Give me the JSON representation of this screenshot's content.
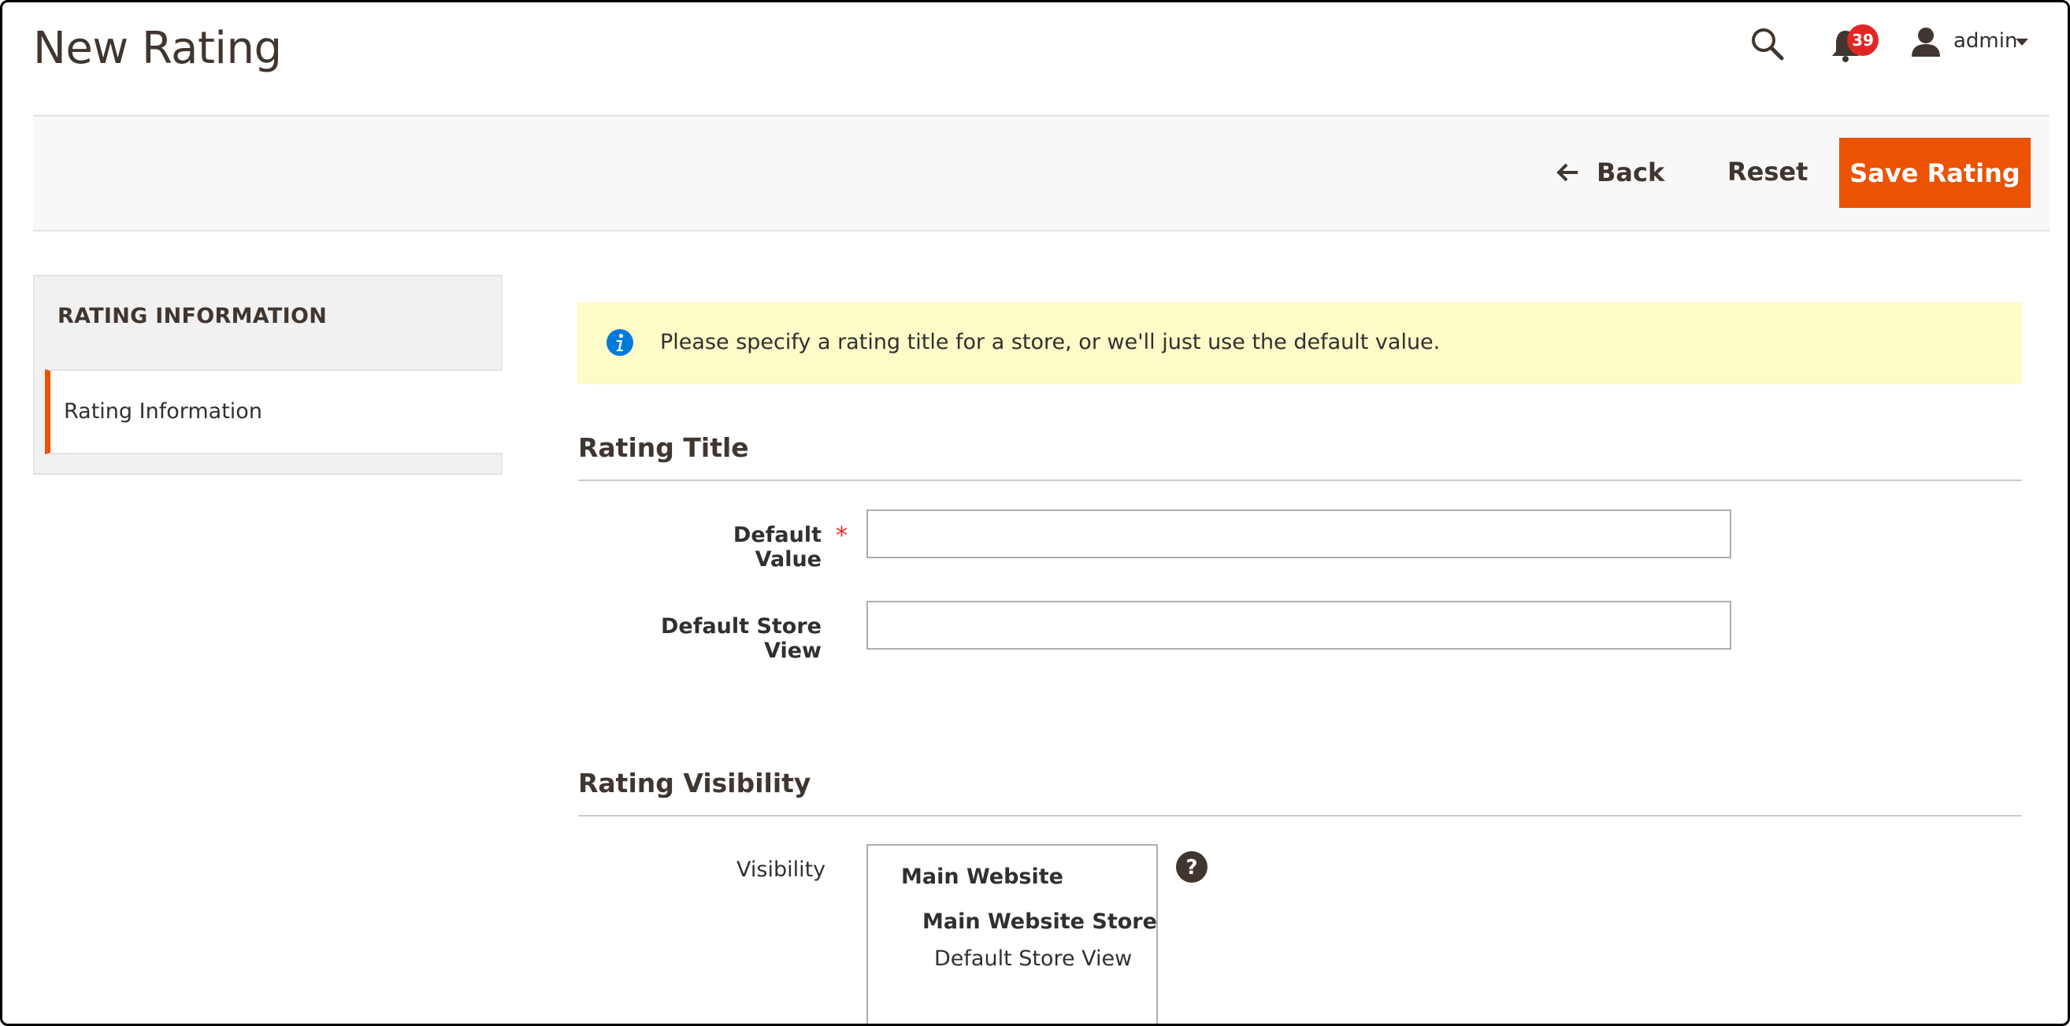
{
  "header": {
    "title": "New Rating",
    "notifications_count": "39",
    "user_name": "admin",
    "icons": [
      "search-icon",
      "bell-icon",
      "user-icon",
      "caret-down-icon"
    ]
  },
  "actions": {
    "back_label": "Back",
    "reset_label": "Reset",
    "save_label": "Save Rating"
  },
  "tabs": {
    "heading": "RATING INFORMATION",
    "items": [
      {
        "label": "Rating Information",
        "active": true
      }
    ]
  },
  "message": {
    "text": "Please specify a rating title for a store, or we'll just use the default value."
  },
  "rating_title": {
    "heading": "Rating Title",
    "fields": [
      {
        "label": "Default Value",
        "required": true,
        "value": ""
      },
      {
        "label": "Default Store View",
        "required": false,
        "value": ""
      }
    ]
  },
  "rating_visibility": {
    "heading": "Rating Visibility",
    "label": "Visibility",
    "options": {
      "website": "Main Website",
      "store": "Main Website Store",
      "store_view": "Default Store View"
    }
  },
  "colors": {
    "accent": "#eb5202",
    "badge": "#e22626",
    "info_bg": "#fdfbc7",
    "info_icon": "#007bdb",
    "required": "#e02b27"
  }
}
